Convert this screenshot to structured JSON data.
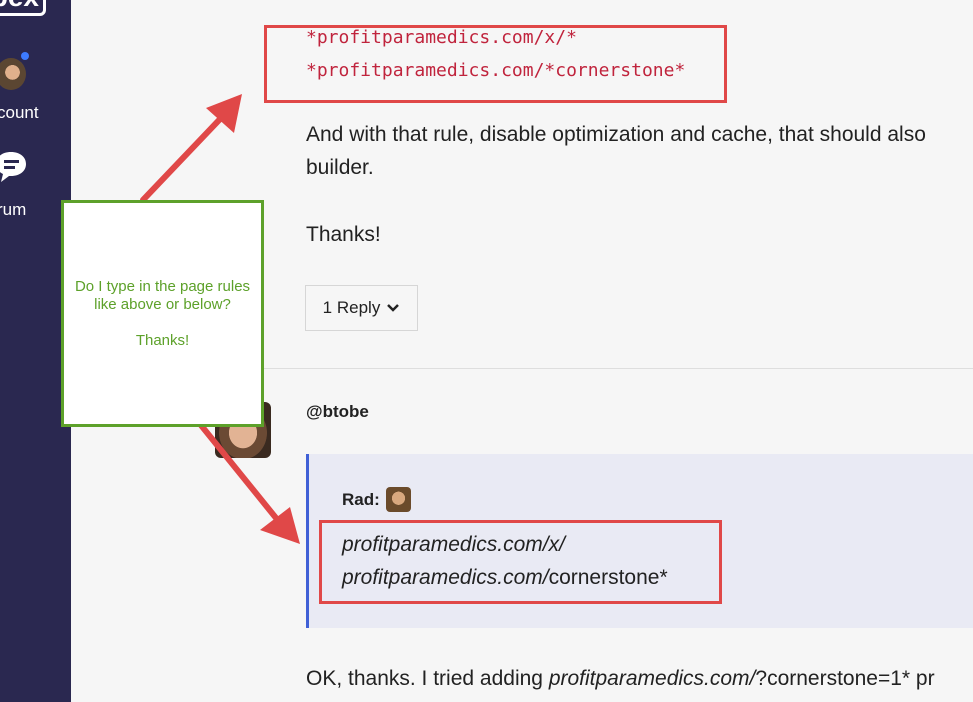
{
  "sidebar": {
    "logo_text": "bex",
    "items": [
      {
        "label": "count",
        "icon": "avatar"
      },
      {
        "label": "rum",
        "icon": "chat-bubble-icon"
      }
    ]
  },
  "post": {
    "code_lines": [
      "*profitparamedics.com/x/*",
      "*profitparamedics.com/*cornerstone*"
    ],
    "paragraph_lines": [
      "And with that rule, disable optimization and cache, that should also",
      "builder."
    ],
    "thanks": "Thanks!",
    "reply_button_label": "1 Reply"
  },
  "reply": {
    "username": "@btobe",
    "quote_author": "Rad:",
    "quote_line_1_italic": "profitparamedics.com/x/",
    "quote_line_2_italic": "profitparamedics.com/",
    "quote_line_2_regular": "cornerstone*",
    "body_prefix": "OK, thanks. I tried adding ",
    "body_italic": "profitparamedics.com/",
    "body_suffix": "?cornerstone=1* pr"
  },
  "annotation": {
    "line1": "Do I type in the page rules",
    "line2": "like above or below?",
    "line3": "Thanks!"
  },
  "colors": {
    "sidebar_bg": "#2a2850",
    "code_red": "#c0243d",
    "annotation_red": "#e04848",
    "note_green": "#5da12a",
    "quote_border": "#4060d6"
  }
}
